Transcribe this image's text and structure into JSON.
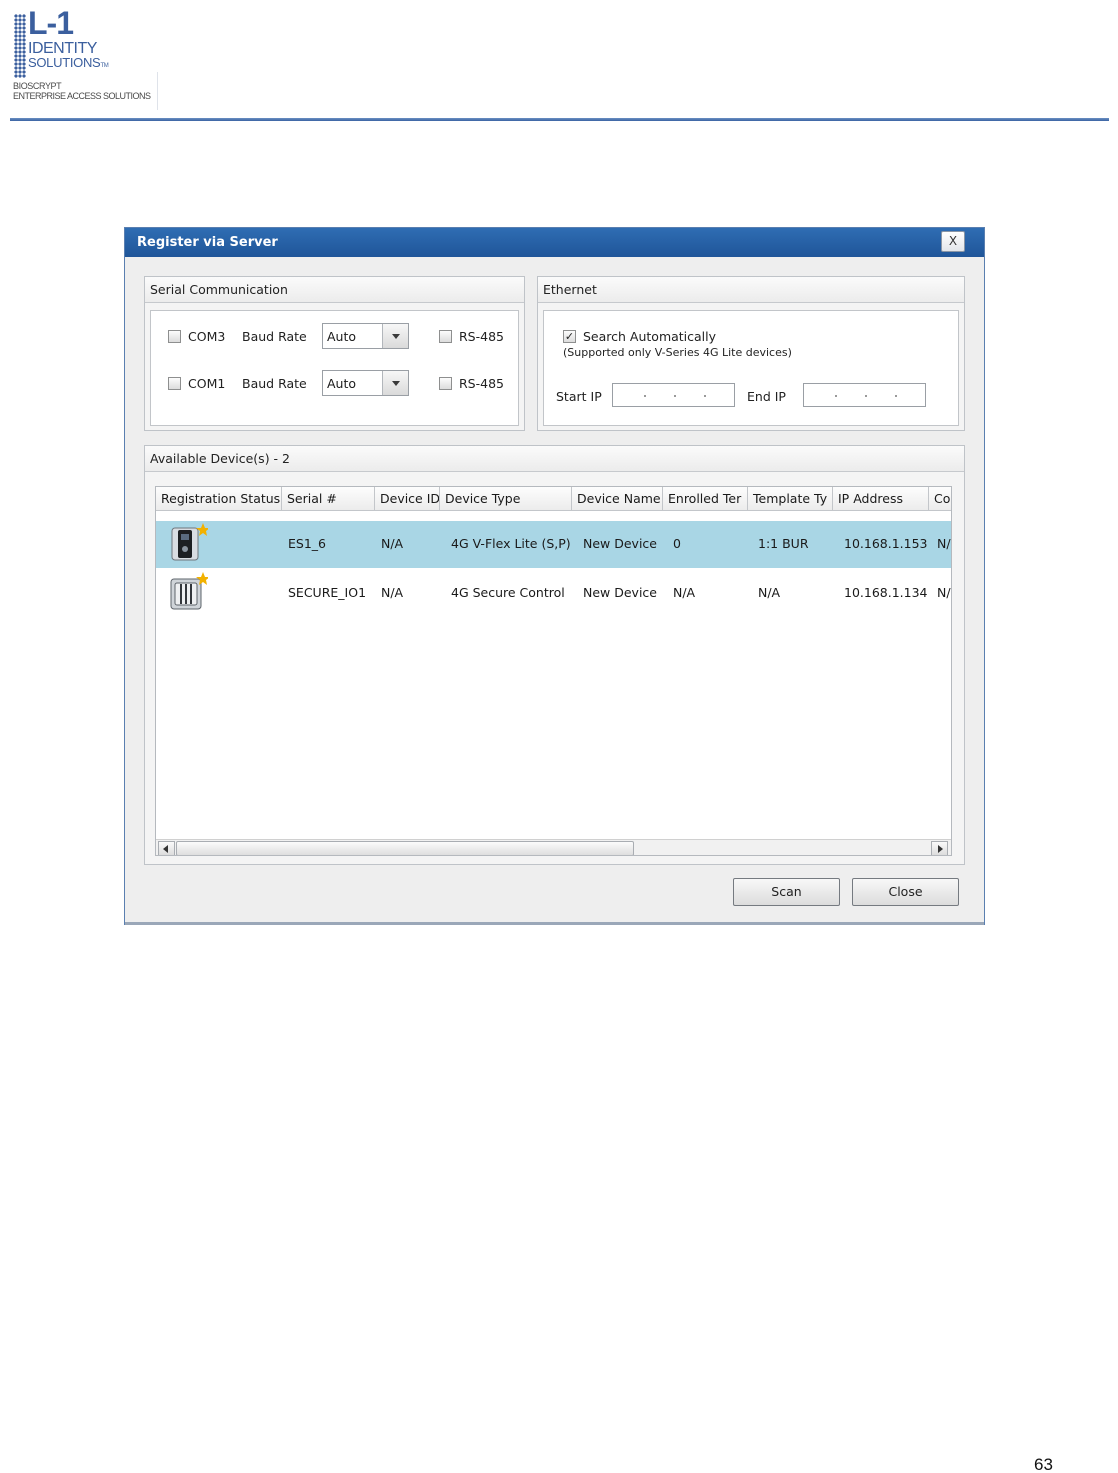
{
  "document": {
    "logo": {
      "mark": "L-1",
      "line1": "IDENTITY",
      "line2": "SOLUTIONS",
      "tm": "TM",
      "line3": "BIOSCRYPT",
      "line4": "ENTERPRISE ACCESS SOLUTIONS"
    },
    "page_number": "63",
    "accent_color": "#3a63a3"
  },
  "dialog": {
    "title": "Register via Server",
    "close_label": "X",
    "serial": {
      "title": "Serial Communication",
      "ports": [
        {
          "port": "COM3",
          "baud_label": "Baud Rate",
          "baud_value": "Auto",
          "rs485_label": "RS-485",
          "checked": false,
          "rs485_checked": false
        },
        {
          "port": "COM1",
          "baud_label": "Baud Rate",
          "baud_value": "Auto",
          "rs485_label": "RS-485",
          "checked": false,
          "rs485_checked": false
        }
      ]
    },
    "ethernet": {
      "title": "Ethernet",
      "search_label": "Search Automatically",
      "search_checked": true,
      "search_note": "(Supported only V-Series 4G Lite devices)",
      "start_ip_label": "Start IP",
      "end_ip_label": "End IP",
      "start_ip_value": "",
      "end_ip_value": ""
    },
    "devices": {
      "title": "Available Device(s) - 2",
      "columns": [
        "Registration Status",
        "Serial #",
        "Device ID",
        "Device Type",
        "Device Name",
        "Enrolled Ter",
        "Template Ty",
        "IP Address",
        "Co"
      ],
      "rows": [
        {
          "icon": "v-flex-device-icon",
          "serial": "ES1_6",
          "device_id": "N/A",
          "device_type": "4G V-Flex Lite (S,P)",
          "device_name": "New Device",
          "enrolled": "0",
          "template": "1:1 BUR",
          "ip": "10.168.1.153",
          "co": "N/",
          "selected": true
        },
        {
          "icon": "secure-control-device-icon",
          "serial": "SECURE_IO1",
          "device_id": "N/A",
          "device_type": "4G Secure Control",
          "device_name": "New Device",
          "enrolled": "N/A",
          "template": "N/A",
          "ip": "10.168.1.134",
          "co": "N/",
          "selected": false
        }
      ],
      "selected_row_color": "#a9d6e5"
    },
    "buttons": {
      "scan": "Scan",
      "close": "Close"
    }
  }
}
